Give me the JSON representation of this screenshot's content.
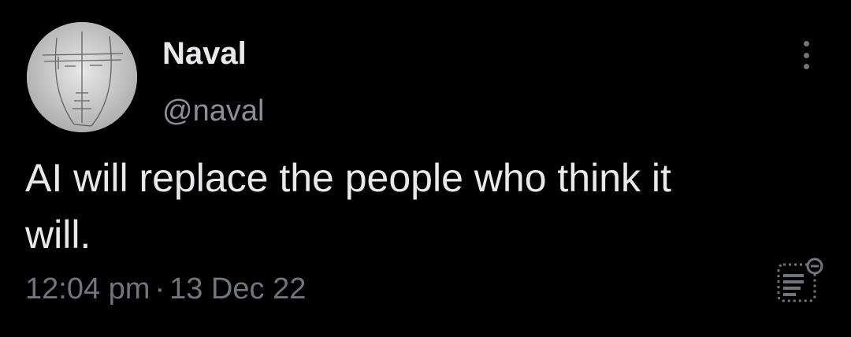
{
  "author": {
    "display_name": "Naval",
    "handle": "@naval"
  },
  "tweet": {
    "text": "AI will replace the people who think it\nwill.",
    "time": "12:04 pm",
    "separator": "·",
    "date": "13 Dec 22"
  },
  "icons": {
    "more": "more-vertical-icon",
    "notes": "community-notes-icon"
  },
  "colors": {
    "background": "#000000",
    "primary_text": "#e7e9ea",
    "secondary_text": "#71767b"
  }
}
